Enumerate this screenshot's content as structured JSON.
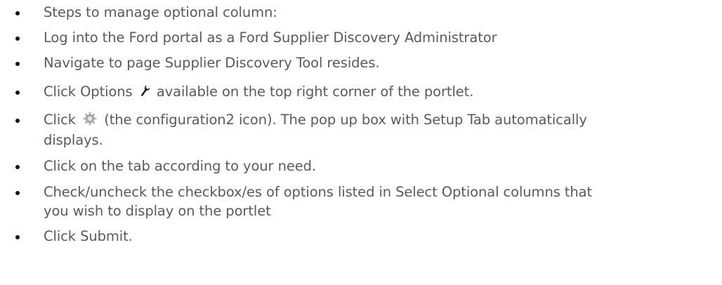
{
  "steps": [
    {
      "text": "Steps to manage optional column:"
    },
    {
      "text": "Log into the Ford portal as a Ford Supplier Discovery Administrator"
    },
    {
      "text": "Navigate to page Supplier Discovery Tool resides."
    },
    {
      "before": "Click Options",
      "icon": "wrench-icon",
      "after": "available on the top right corner of the portlet."
    },
    {
      "before": "Click",
      "icon": "gear-icon",
      "after_line1": "(the configuration2 icon). The pop up box with Setup Tab automatically",
      "after_line2": "displays."
    },
    {
      "text": "Click on the tab according to your need."
    },
    {
      "line1": "Check/uncheck the checkbox/es of options listed in Select Optional columns that",
      "line2": "you wish to display on the portlet"
    },
    {
      "text": "Click Submit."
    }
  ],
  "colors": {
    "text": "#5a5a5a",
    "bullet": "#111111"
  }
}
